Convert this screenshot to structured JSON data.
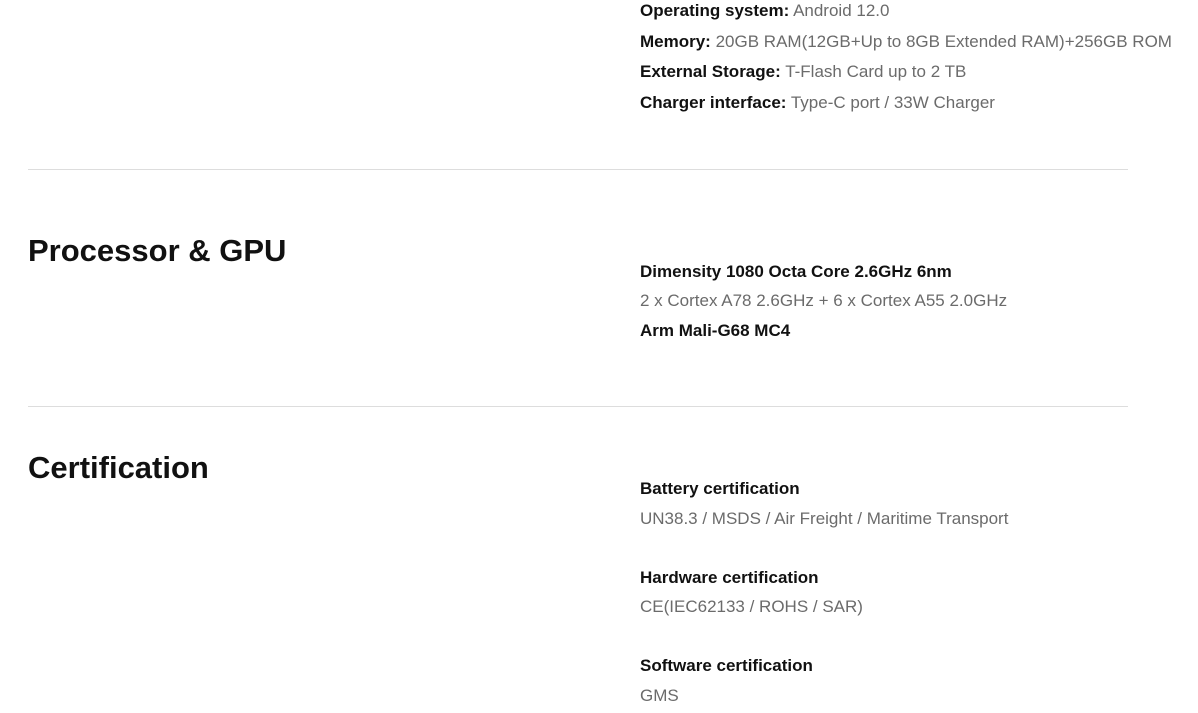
{
  "specs": {
    "os": {
      "label": "Operating system:",
      "value": "Android 12.0"
    },
    "memory": {
      "label": "Memory:",
      "value": "20GB RAM(12GB+Up to 8GB Extended RAM)+256GB ROM"
    },
    "external_storage": {
      "label": "External Storage:",
      "value": "T-Flash Card up to 2 TB"
    },
    "charger": {
      "label": "Charger interface:",
      "value": "Type-C port / 33W Charger"
    }
  },
  "processor_section": {
    "title": "Processor & GPU",
    "chip": "Dimensity 1080  Octa Core  2.6GHz  6nm",
    "cores": "2 x Cortex A78 2.6GHz + 6 x Cortex A55 2.0GHz",
    "gpu": "Arm Mali-G68 MC4"
  },
  "certification_section": {
    "title": "Certification",
    "items": [
      {
        "heading": "Battery certification",
        "value": "UN38.3 / MSDS / Air Freight / Maritime Transport"
      },
      {
        "heading": "Hardware certification",
        "value": "CE(IEC62133 / ROHS / SAR)"
      },
      {
        "heading": "Software certification",
        "value": "GMS"
      }
    ]
  }
}
